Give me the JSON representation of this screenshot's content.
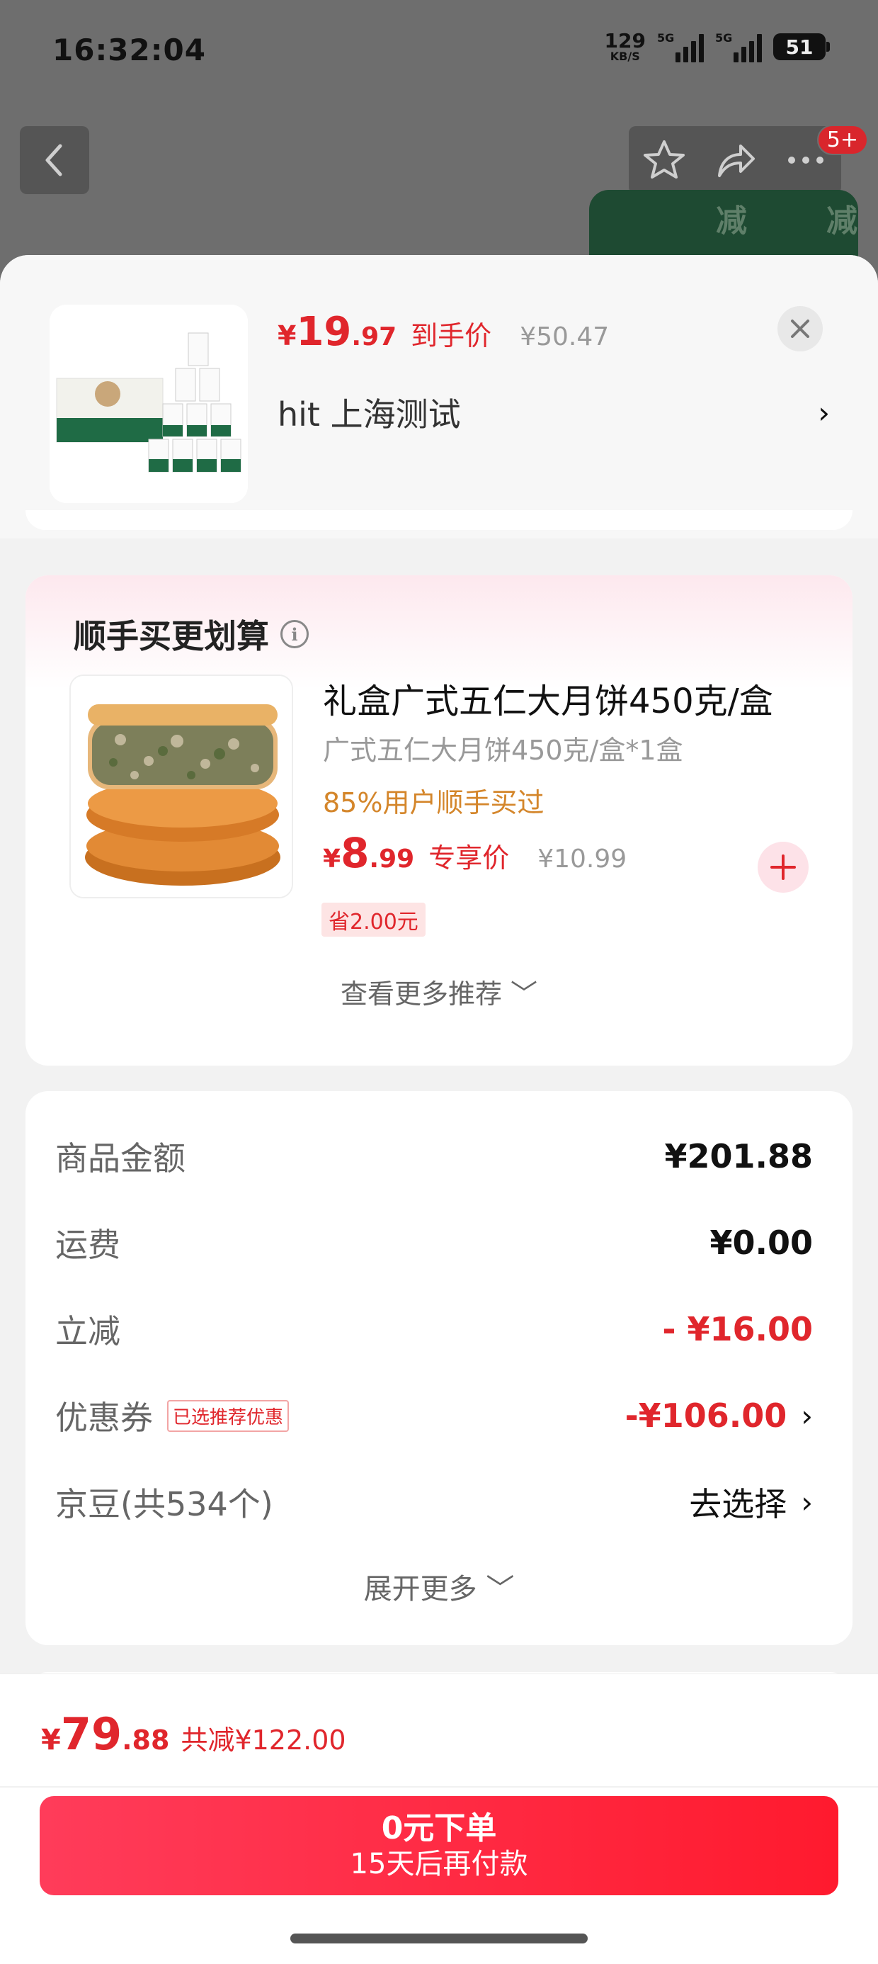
{
  "status_bar": {
    "time": "16:32:04",
    "net_speed": "129",
    "net_unit": "KB/S",
    "signal1_label": "5G",
    "signal2_label": "5G",
    "battery": "51"
  },
  "background_page": {
    "message_badge": "5+",
    "icons": [
      "back-icon",
      "star-icon",
      "share-icon",
      "more-icon"
    ]
  },
  "product": {
    "price_currency": "¥",
    "price_int": "19",
    "price_dec": ".97",
    "price_tag": "到手价",
    "original_price": "¥50.47",
    "address": "hit  上海测试",
    "address_chevron": "›",
    "close_icon": "close-icon"
  },
  "addon": {
    "title": "顺手买更划算",
    "info_icon": "i",
    "name": "礼盒广式五仁大月饼450克/盒",
    "spec": "广式五仁大月饼450克/盒*1盒",
    "social_proof": "85%用户顺手买过",
    "price_currency": "¥",
    "price_int": "8",
    "price_dec": ".99",
    "price_tag": "专享价",
    "original_price": "¥10.99",
    "save_badge": "省2.00元",
    "more_label": "查看更多推荐 ﹀"
  },
  "summary": {
    "rows": [
      {
        "label": "商品金额",
        "value": "¥201.88"
      },
      {
        "label": "运费",
        "value": "¥0.00"
      },
      {
        "label": "立减",
        "value": "- ¥16.00"
      },
      {
        "label": "优惠券",
        "badge": "已选推荐优惠",
        "value": "-¥106.00",
        "chevron": "›"
      },
      {
        "label": "京豆(共534个)",
        "value": "去选择",
        "chevron": "›"
      }
    ],
    "expand_label": "展开更多 ﹀"
  },
  "footer": {
    "total_currency": "¥",
    "total_int": "79",
    "total_dec": ".88",
    "total_saved": "共减¥122.00",
    "submit_line1": "0元下单",
    "submit_line2": "15天后再付款"
  },
  "colors": {
    "accent_red": "#e0262c",
    "social_orange": "#d4862b",
    "dim_overlay": "#6e6e6e"
  }
}
